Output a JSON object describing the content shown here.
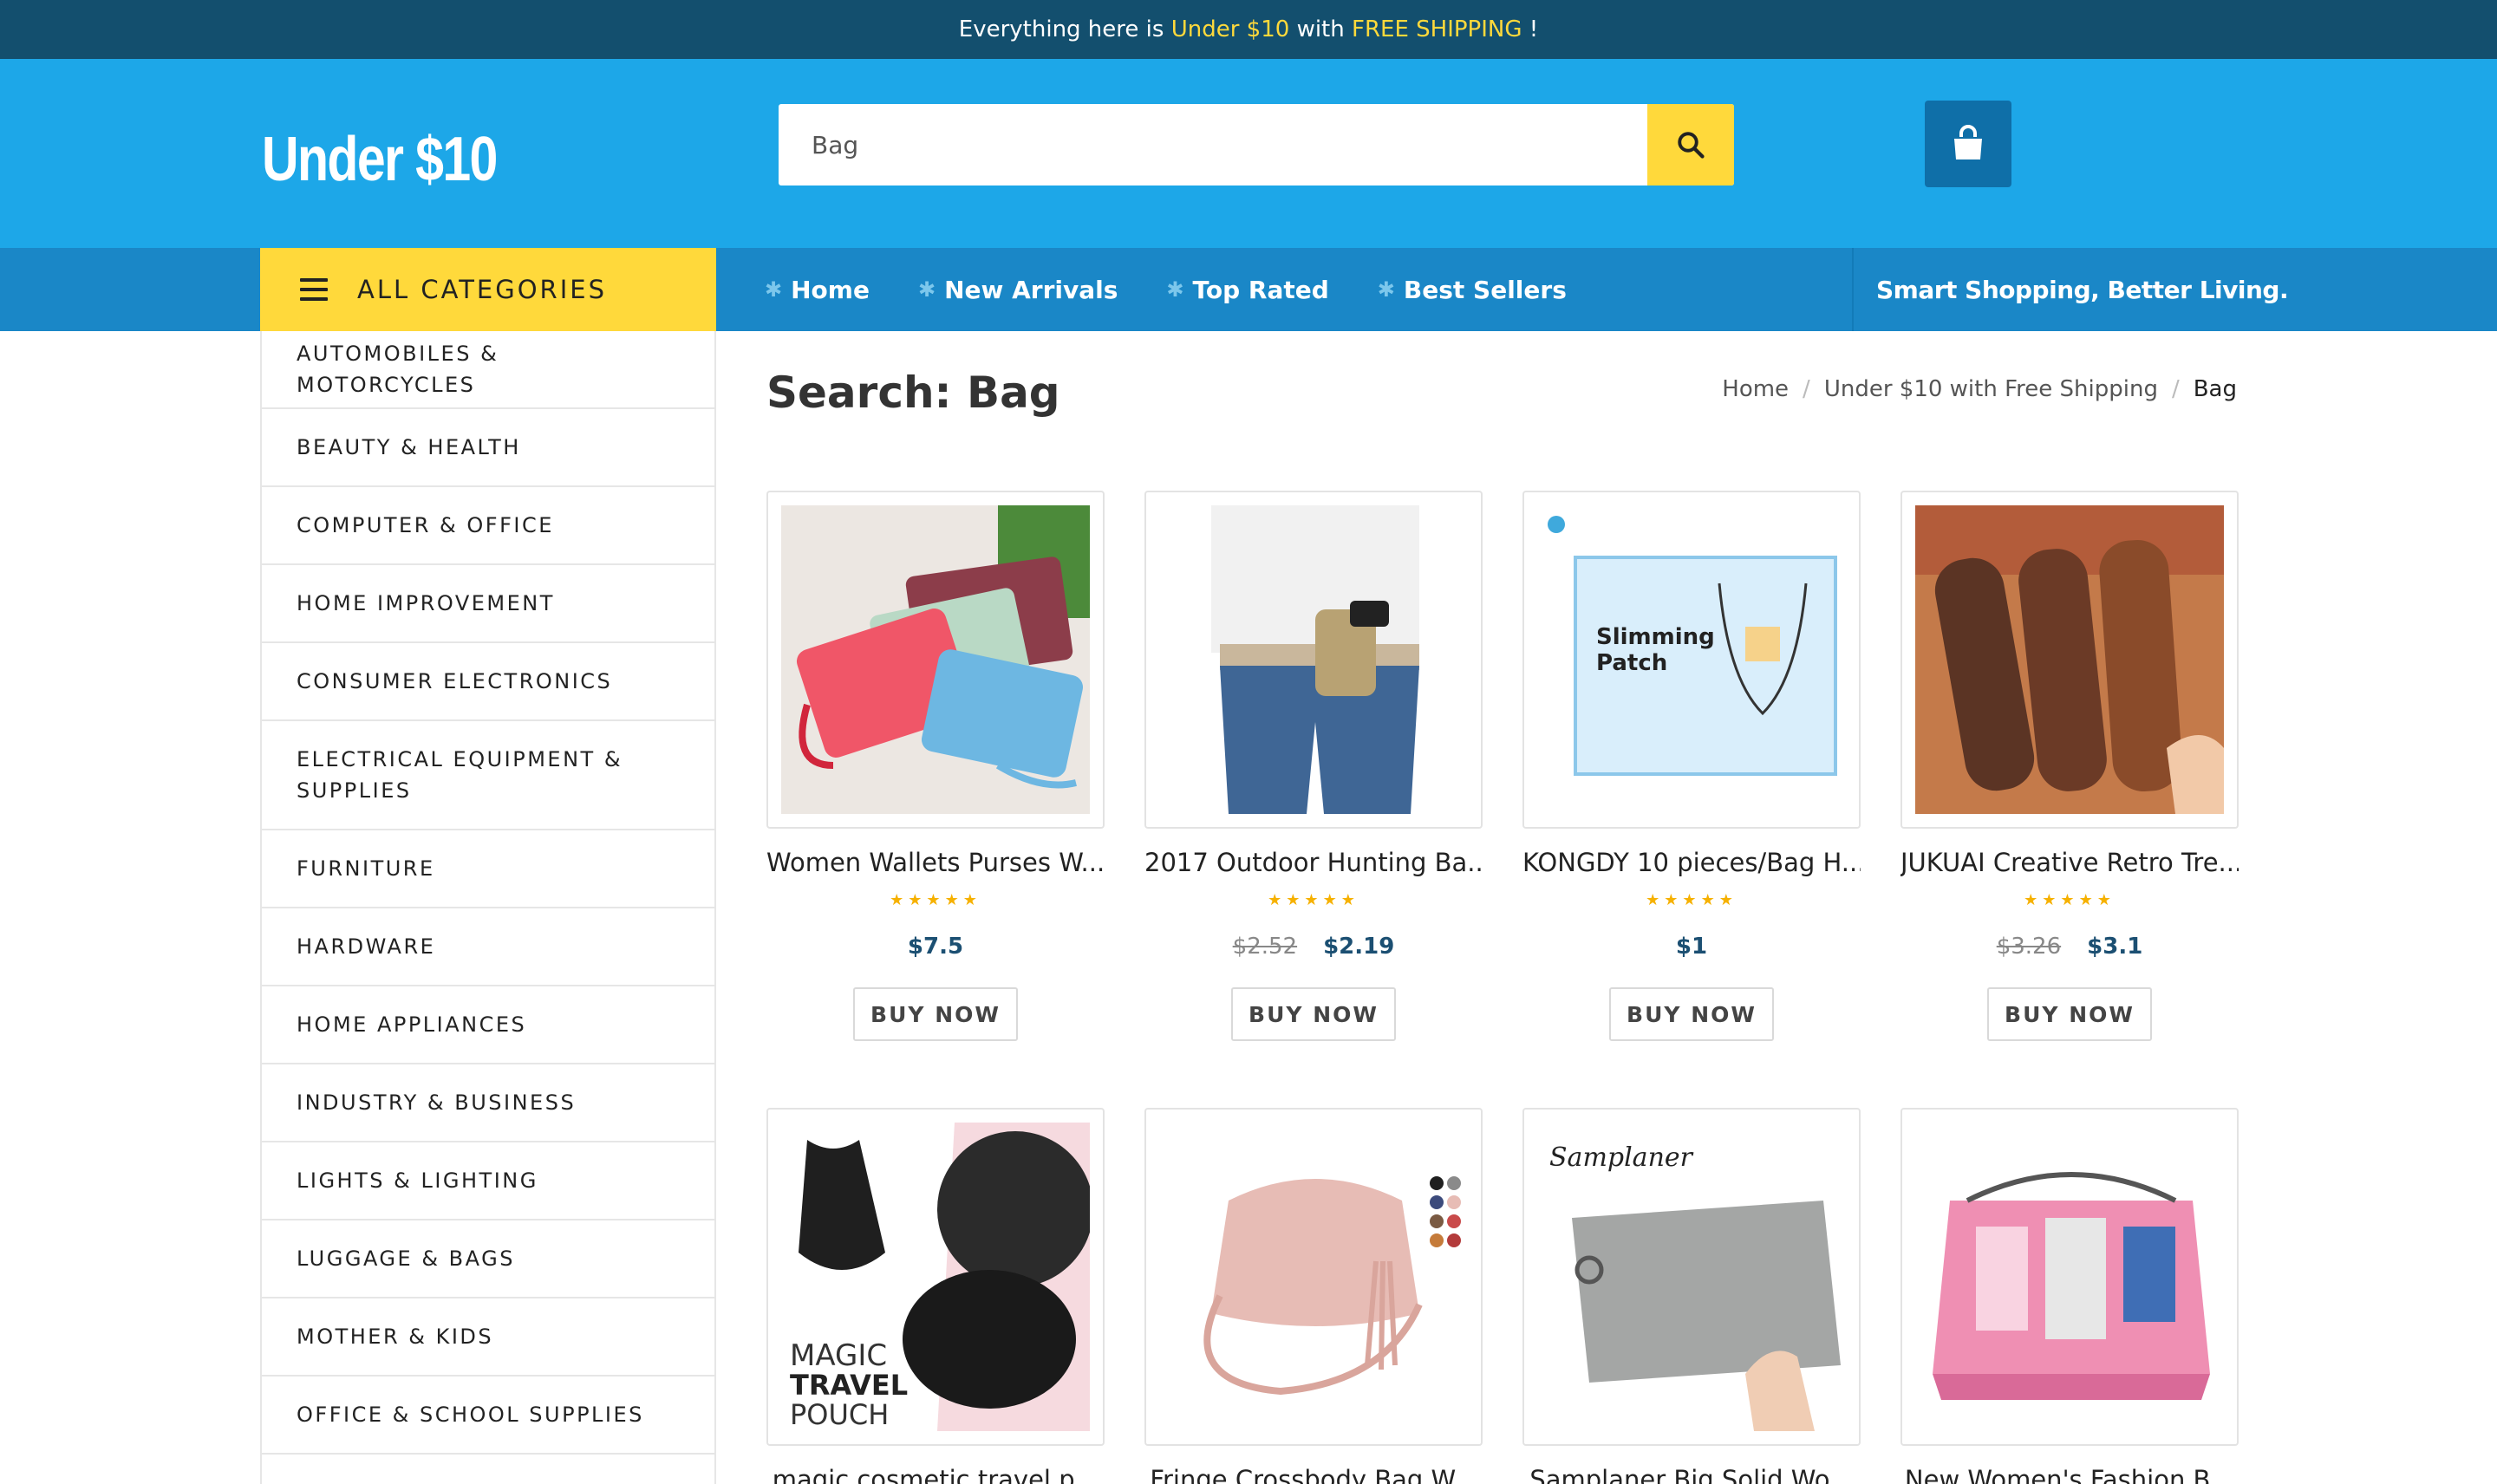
{
  "topbar": {
    "text_before": "Everything here is",
    "highlight_price": "Under $10",
    "text_mid": "with",
    "highlight_shipping": "FREE SHIPPING",
    "text_end": "!"
  },
  "header": {
    "logo": "Under $10",
    "search_value": "Bag",
    "search_icon": "search-icon",
    "cart_icon": "shopping-bag-icon"
  },
  "nav": {
    "all_categories": "ALL CATEGORIES",
    "links": [
      "Home",
      "New Arrivals",
      "Top Rated",
      "Best Sellers"
    ],
    "tagline": "Smart Shopping, Better Living."
  },
  "sidebar": {
    "categories": [
      "AUTOMOBILES & MOTORCYCLES",
      "BEAUTY & HEALTH",
      "COMPUTER & OFFICE",
      "HOME IMPROVEMENT",
      "CONSUMER ELECTRONICS",
      "ELECTRICAL EQUIPMENT & SUPPLIES",
      "FURNITURE",
      "HARDWARE",
      "HOME APPLIANCES",
      "INDUSTRY & BUSINESS",
      "LIGHTS & LIGHTING",
      "LUGGAGE & BAGS",
      "MOTHER & KIDS",
      "OFFICE & SCHOOL SUPPLIES"
    ]
  },
  "page": {
    "title": "Search: Bag",
    "breadcrumb": [
      "Home",
      "Under $10 with Free Shipping",
      "Bag"
    ]
  },
  "products": [
    {
      "name": "Women Wallets Purses W...",
      "old_price": "",
      "price": "$7.5",
      "rating": 5,
      "button": "BUY NOW"
    },
    {
      "name": "2017 Outdoor Hunting Ba...",
      "old_price": "$2.52",
      "price": "$2.19",
      "rating": 5,
      "button": "BUY NOW"
    },
    {
      "name": "KONGDY 10 pieces/Bag H...",
      "old_price": "",
      "price": "$1",
      "rating": 5,
      "button": "BUY NOW",
      "image_text": [
        "Slimming",
        "Patch"
      ]
    },
    {
      "name": "JUKUAI Creative Retro Tre...",
      "old_price": "$3.26",
      "price": "$3.1",
      "rating": 5,
      "button": "BUY NOW"
    },
    {
      "name": "magic cosmetic travel p...",
      "image_text": [
        "MAGIC",
        "TRAVEL",
        "POUCH"
      ]
    },
    {
      "name": "Fringe Crossbody Bag W..."
    },
    {
      "name": "Samplaner Big Solid Wo...",
      "image_text": [
        "Samplaner"
      ]
    },
    {
      "name": "New Women's Fashion B..."
    }
  ]
}
